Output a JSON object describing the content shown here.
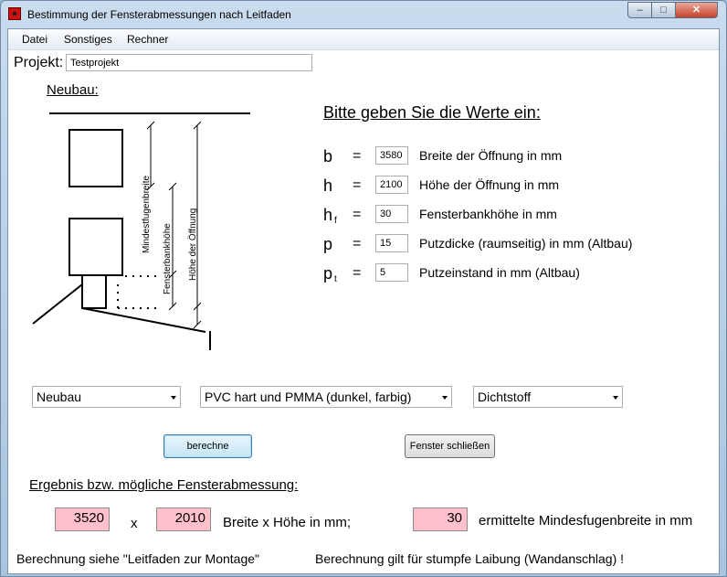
{
  "window": {
    "title": "Bestimmung der Fensterabmessungen nach Leitfaden",
    "minimize": "–",
    "maximize": "□",
    "close": "✕"
  },
  "menu": [
    "Datei",
    "Sonstiges",
    "Rechner"
  ],
  "project": {
    "label": "Projekt:",
    "value": "Testprojekt"
  },
  "section": "Neubau:",
  "diagram": {
    "labels": [
      "Mindestfugenbreite",
      "Fensterbankhöhe",
      "Höhe der Öffnung"
    ]
  },
  "inputs": {
    "heading": "Bitte geben Sie die Werte ein:",
    "rows": [
      {
        "var": "b",
        "sub": "",
        "eq": "=",
        "value": "3580",
        "desc": "Breite der Öffnung in mm"
      },
      {
        "var": "h",
        "sub": "",
        "eq": "=",
        "value": "2100",
        "desc": "Höhe der Öffnung in mm"
      },
      {
        "var": "h",
        "sub": "f",
        "eq": "=",
        "value": "30",
        "desc": "Fensterbankhöhe in mm"
      },
      {
        "var": "p",
        "sub": "",
        "eq": "=",
        "value": "15",
        "desc": "Putzdicke (raumseitig) in mm (Altbau)"
      },
      {
        "var": "p",
        "sub": "t",
        "eq": "=",
        "value": "5",
        "desc": "Putzeinstand in mm (Altbau)"
      }
    ]
  },
  "combos": [
    "Neubau",
    "PVC hart und PMMA (dunkel, farbig)",
    "Dichtstoff"
  ],
  "buttons": {
    "calculate": "berechne",
    "close": "Fenster schließen"
  },
  "result": {
    "heading": "Ergebnis bzw. mögliche Fensterabmessung:",
    "width": "3520",
    "x": "x",
    "height": "2010",
    "dim_label": "Breite x Höhe in mm;",
    "joint": "30",
    "joint_label": "ermittelte Mindesfugenbreite in mm"
  },
  "footer": {
    "left": "Berechnung siehe \"Leitfaden zur Montage\"",
    "right": "Berechnung gilt für stumpfe Laibung (Wandanschlag) !"
  }
}
